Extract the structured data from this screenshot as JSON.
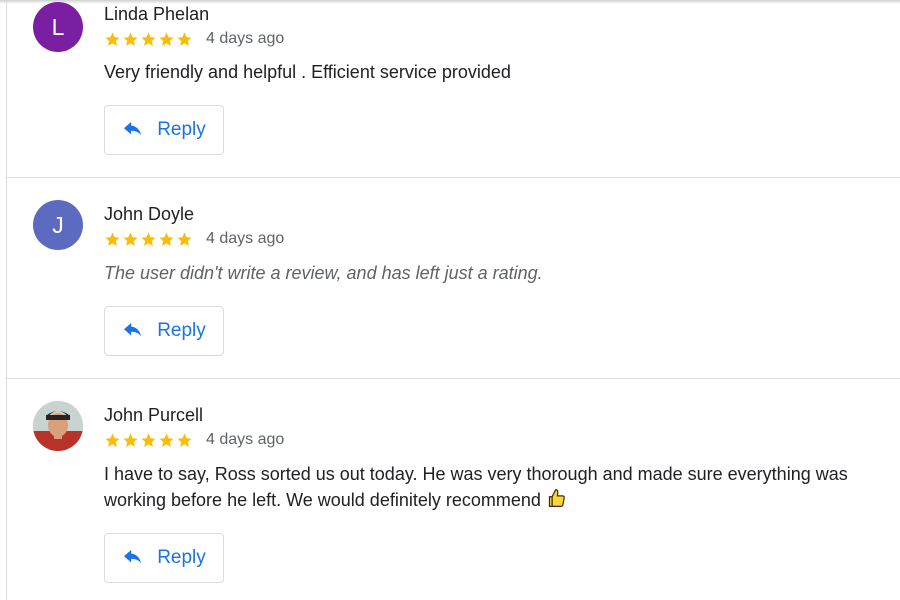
{
  "colors": {
    "star": "#fbbc04",
    "link_blue": "#1a73e8",
    "avatar_l": "#7b1fa2",
    "avatar_j": "#5c6bc0"
  },
  "reviews": [
    {
      "avatar_letter": "L",
      "name": "Linda Phelan",
      "stars": 5,
      "time": "4 days ago",
      "text": "Very friendly and helpful . Efficient service provided",
      "reply_label": "Reply"
    },
    {
      "avatar_letter": "J",
      "name": "John Doyle",
      "stars": 5,
      "time": "4 days ago",
      "text": "The user didn't write a review, and has left just a rating.",
      "reply_label": "Reply"
    },
    {
      "avatar_letter": "",
      "name": "John Purcell",
      "stars": 5,
      "time": "4 days ago",
      "text": "I have to say, Ross sorted us out today. He was very thorough and made sure everything was working before he left. We would definitely recommend",
      "text_emoji": "thumbs-up-icon",
      "reply_label": "Reply"
    }
  ]
}
